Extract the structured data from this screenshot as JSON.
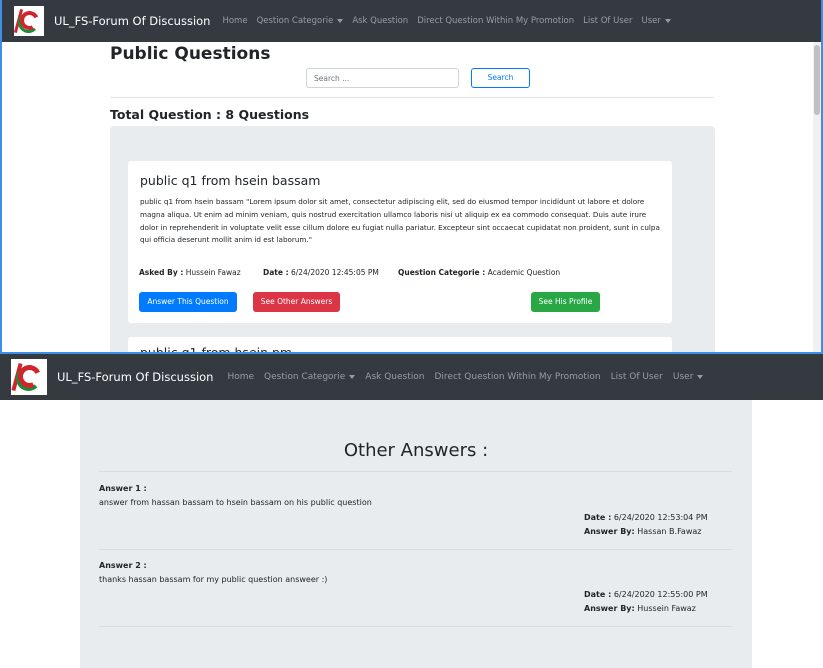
{
  "navbar": {
    "brand": "UL_FS-Forum Of Discussion",
    "links": [
      {
        "label": "Home",
        "dropdown": false
      },
      {
        "label": "Qestion Categorie",
        "dropdown": true
      },
      {
        "label": "Ask Question",
        "dropdown": false
      },
      {
        "label": "Direct Question Within My Promotion",
        "dropdown": false
      },
      {
        "label": "List Of User",
        "dropdown": false
      },
      {
        "label": "User",
        "dropdown": true
      }
    ]
  },
  "public_page": {
    "title": "Public Questions",
    "search_placeholder": "Search ...",
    "search_button": "Search",
    "total_label": "Total Question : 8 Questions",
    "question": {
      "title": "public q1 from hsein bassam",
      "body": "public q1 from hsein bassam \"Lorem ipsum dolor sit amet, consectetur adipiscing elit, sed do eiusmod tempor incididunt ut labore et dolore magna aliqua. Ut enim ad minim veniam, quis nostrud exercitation ullamco laboris nisi ut aliquip ex ea commodo consequat. Duis aute irure dolor in reprehenderit in voluptate velit esse cillum dolore eu fugiat nulla pariatur. Excepteur sint occaecat cupidatat non proident, sunt in culpa qui officia deserunt mollit anim id est laborum.\"",
      "asked_by_label": "Asked By :",
      "asked_by": "Hussein Fawaz",
      "date_label": "Date :",
      "date": "6/24/2020 12:45:05 PM",
      "category_label": "Question Categorie :",
      "category": "Academic Question",
      "answer_button": "Answer This Question",
      "other_answers_button": "See Other Answers",
      "profile_button": "See His Profile"
    },
    "next_question_title_partial": "public q1 from hsein pm"
  },
  "answers_page": {
    "title": "Other Answers :",
    "answers": [
      {
        "label": "Answer 1 :",
        "text": "answer from hassan bassam to hsein bassam on his public question",
        "date_label": "Date :",
        "date": "6/24/2020 12:53:04 PM",
        "by_label": "Answer By:",
        "by": "Hassan B.Fawaz"
      },
      {
        "label": "Answer 2 :",
        "text": "thanks hassan bassam for my public question answeer :)",
        "date_label": "Date :",
        "date": "6/24/2020 12:55:00 PM",
        "by_label": "Answer By:",
        "by": "Hussein Fawaz"
      }
    ]
  },
  "colors": {
    "navbar": "#343a40",
    "primary": "#007bff",
    "danger": "#dc3545",
    "success": "#28a745",
    "panel": "#e9ecef",
    "window_border": "#3c8ee6"
  }
}
